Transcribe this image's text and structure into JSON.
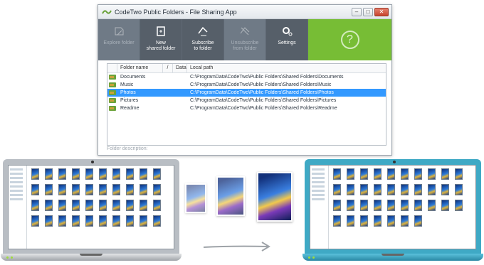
{
  "window": {
    "title": "CodeTwo Public Folders - File Sharing App",
    "buttons": {
      "minimize": "–",
      "maximize": "□",
      "close": "✕"
    }
  },
  "ribbon": {
    "buttons": [
      {
        "label": "Explore folder",
        "enabled": false,
        "icon": "explore-icon"
      },
      {
        "label": "New\nshared folder",
        "enabled": true,
        "icon": "new-folder-icon"
      },
      {
        "label": "Subscribe\nto folder",
        "enabled": true,
        "icon": "subscribe-icon"
      },
      {
        "label": "Unsubscribe\nfrom folder",
        "enabled": false,
        "icon": "unsubscribe-icon"
      },
      {
        "label": "Settings",
        "enabled": true,
        "icon": "settings-icon"
      }
    ],
    "help": "?"
  },
  "table": {
    "headers": {
      "name": "Folder name",
      "slash": "/",
      "data": "Data",
      "path": "Local path"
    },
    "rows": [
      {
        "name": "Documents",
        "path": "C:\\ProgramData\\CodeTwo\\Public Folders\\Shared Folders\\Documents",
        "selected": false
      },
      {
        "name": "Music",
        "path": "C:\\ProgramData\\CodeTwo\\Public Folders\\Shared Folders\\Music",
        "selected": false
      },
      {
        "name": "Photos",
        "path": "C:\\ProgramData\\CodeTwo\\Public Folders\\Shared Folders\\Photos",
        "selected": true
      },
      {
        "name": "Pictures",
        "path": "C:\\ProgramData\\CodeTwo\\Public Folders\\Shared Folders\\Pictures",
        "selected": false
      },
      {
        "name": "Readme",
        "path": "C:\\ProgramData\\CodeTwo\\Public Folders\\Shared Folders\\Readme",
        "selected": false
      }
    ]
  },
  "description_placeholder": "Folder description:",
  "colors": {
    "ribbon": "#6f7a86",
    "help_panel": "#77bd35",
    "selection": "#3399ff",
    "laptop_right": "#3fa9c5",
    "laptop_left": "#b9bec4"
  }
}
